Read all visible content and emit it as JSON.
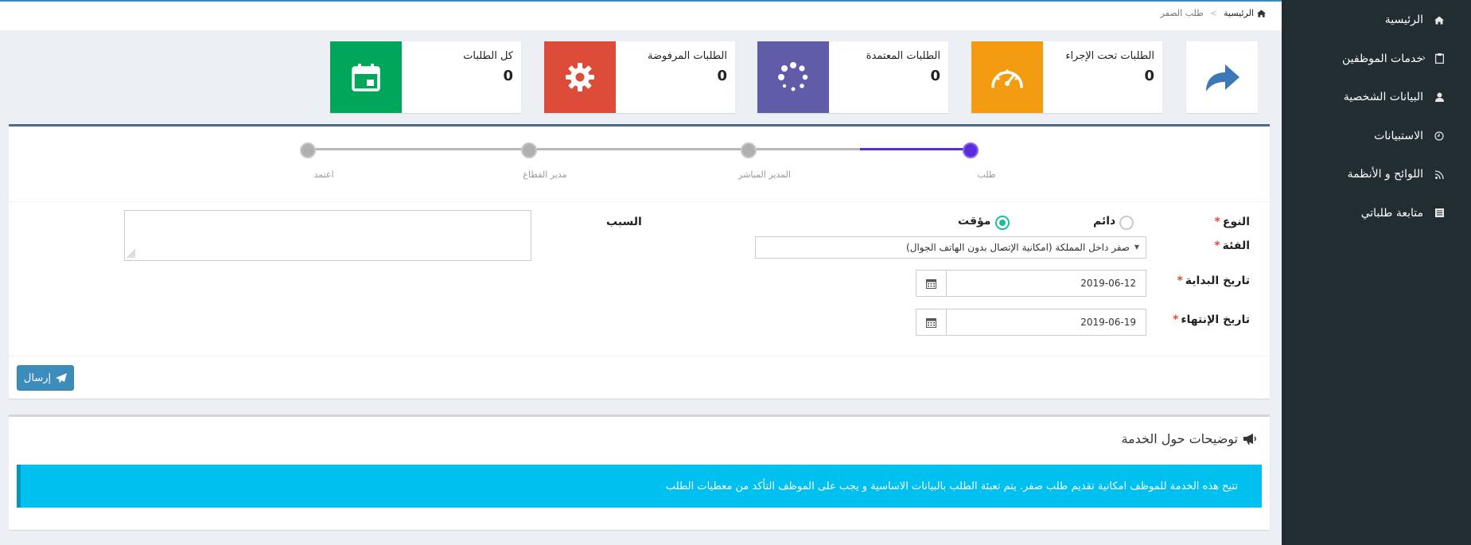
{
  "breadcrumb": {
    "home": "الرئيسية",
    "separator": ">",
    "current": "طلب الصفر"
  },
  "sidebar": {
    "items": [
      {
        "label": "الرئيسية",
        "icon": "home-icon"
      },
      {
        "label": "خدمات الموظفين",
        "icon": "clipboard-icon"
      },
      {
        "label": "البيانات الشخصية",
        "icon": "user-icon"
      },
      {
        "label": "الاستبيانات",
        "icon": "clock-icon"
      },
      {
        "label": "اللوائح و الأنظمة",
        "icon": "rss-icon"
      },
      {
        "label": "متابعة طلباتي",
        "icon": "list-icon"
      }
    ]
  },
  "stats": [
    {
      "label": "الطلبات تحت الإجراء",
      "value": "0",
      "color": "#f39c12",
      "icon": "speedometer-icon"
    },
    {
      "label": "الطلبات المعتمدة",
      "value": "0",
      "color": "#605ca8",
      "icon": "spinner-icon"
    },
    {
      "label": "الطلبات المرفوضة",
      "value": "0",
      "color": "#dd4b39",
      "icon": "gear-icon"
    },
    {
      "label": "كل الطلبات",
      "value": "0",
      "color": "#00a65a",
      "icon": "calendar-icon"
    }
  ],
  "steps": [
    {
      "label": "طلب",
      "active": true
    },
    {
      "label": "المدير المباشر",
      "active": false
    },
    {
      "label": "مدير القطاع",
      "active": false
    },
    {
      "label": "اعتمد",
      "active": false
    }
  ],
  "form": {
    "type_label": "النوع",
    "type_options": [
      "دائم",
      "مؤقت"
    ],
    "type_selected": "مؤقت",
    "category_label": "الفئة",
    "category_value": "صفر داخل المملكة (امكانية الإتصال بدون الهاتف الجوال)",
    "start_label": "تاريخ البداية",
    "start_value": "2019-06-12",
    "end_label": "تاريخ الإنتهاء",
    "end_value": "2019-06-19",
    "reason_label": "السبب",
    "required_mark": "*",
    "submit_label": "إرسال"
  },
  "info": {
    "title": "توضيحات حول الخدمة",
    "text": "تتيح هذه الخدمة للموظف امكانية تقديم طلب صفر. يتم تعبئة الطلب بالبيانات الاساسية و يجب على الموظف التأكد من معطيات الطلب"
  },
  "colors": {
    "sidebar": "#222d32",
    "primary": "#3c8dbc",
    "step_active": "#5b2be0",
    "callout": "#00c0ef"
  }
}
